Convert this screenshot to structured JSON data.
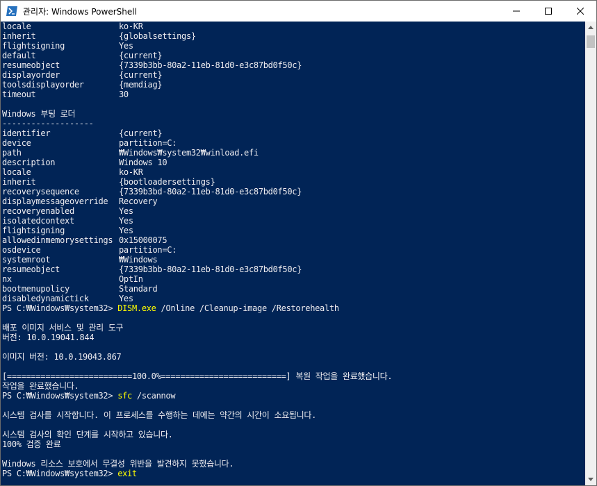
{
  "window": {
    "title": "관리자: Windows PowerShell"
  },
  "console": {
    "kv_top": [
      {
        "key": "locale",
        "value": "ko-KR"
      },
      {
        "key": "inherit",
        "value": "{globalsettings}"
      },
      {
        "key": "flightsigning",
        "value": "Yes"
      },
      {
        "key": "default",
        "value": "{current}"
      },
      {
        "key": "resumeobject",
        "value": "{7339b3bb-80a2-11eb-81d0-e3c87bd0f50c}"
      },
      {
        "key": "displayorder",
        "value": "{current}"
      },
      {
        "key": "toolsdisplayorder",
        "value": "{memdiag}"
      },
      {
        "key": "timeout",
        "value": "30"
      }
    ],
    "loader_heading": "Windows 부팅 로더",
    "loader_rule": "-------------------",
    "kv_loader": [
      {
        "key": "identifier",
        "value": "{current}"
      },
      {
        "key": "device",
        "value": "partition=C:"
      },
      {
        "key": "path",
        "value": "₩Windows₩system32₩winload.efi"
      },
      {
        "key": "description",
        "value": "Windows 10"
      },
      {
        "key": "locale",
        "value": "ko-KR"
      },
      {
        "key": "inherit",
        "value": "{bootloadersettings}"
      },
      {
        "key": "recoverysequence",
        "value": "{7339b3bd-80a2-11eb-81d0-e3c87bd0f50c}"
      },
      {
        "key": "displaymessageoverride",
        "value": "Recovery"
      },
      {
        "key": "recoveryenabled",
        "value": "Yes"
      },
      {
        "key": "isolatedcontext",
        "value": "Yes"
      },
      {
        "key": "flightsigning",
        "value": "Yes"
      },
      {
        "key": "allowedinmemorysettings",
        "value": "0x15000075"
      },
      {
        "key": "osdevice",
        "value": "partition=C:"
      },
      {
        "key": "systemroot",
        "value": "₩Windows"
      },
      {
        "key": "resumeobject",
        "value": "{7339b3bb-80a2-11eb-81d0-e3c87bd0f50c}"
      },
      {
        "key": "nx",
        "value": "OptIn"
      },
      {
        "key": "bootmenupolicy",
        "value": "Standard"
      },
      {
        "key": "disabledynamictick",
        "value": "Yes"
      }
    ],
    "prompt": "PS C:₩Windows₩system32> ",
    "cmd1_name": "DISM.exe",
    "cmd1_args": " /Online /Cleanup-image /Restorehealth",
    "dism_tool": "배포 이미지 서비스 및 관리 도구",
    "dism_version": "버전: 10.0.19041.844",
    "image_version": "이미지 버전: 10.0.19043.867",
    "progress_line": "[==========================100.0%==========================] 복원 작업을 완료했습니다.",
    "op_complete": "작업을 완료했습니다.",
    "cmd2_name": "sfc",
    "cmd2_args": " /scannow",
    "sfc_start": "시스템 검사를 시작합니다. 이 프로세스를 수행하는 데에는 약간의 시간이 소요됩니다.",
    "sfc_verify": "시스템 검사의 확인 단계를 시작하고 있습니다.",
    "sfc_percent": "100% 검증 완료",
    "sfc_result": "Windows 리소스 보호에서 무결성 위반을 발견하지 못했습니다.",
    "cmd3_name": "exit"
  },
  "colors": {
    "console_bg": "#012456",
    "console_fg": "#eeedf0",
    "command": "#ffff00"
  },
  "icons": {
    "app": "powershell-icon",
    "minimize": "minimize-icon",
    "maximize": "maximize-icon",
    "close": "close-icon"
  }
}
